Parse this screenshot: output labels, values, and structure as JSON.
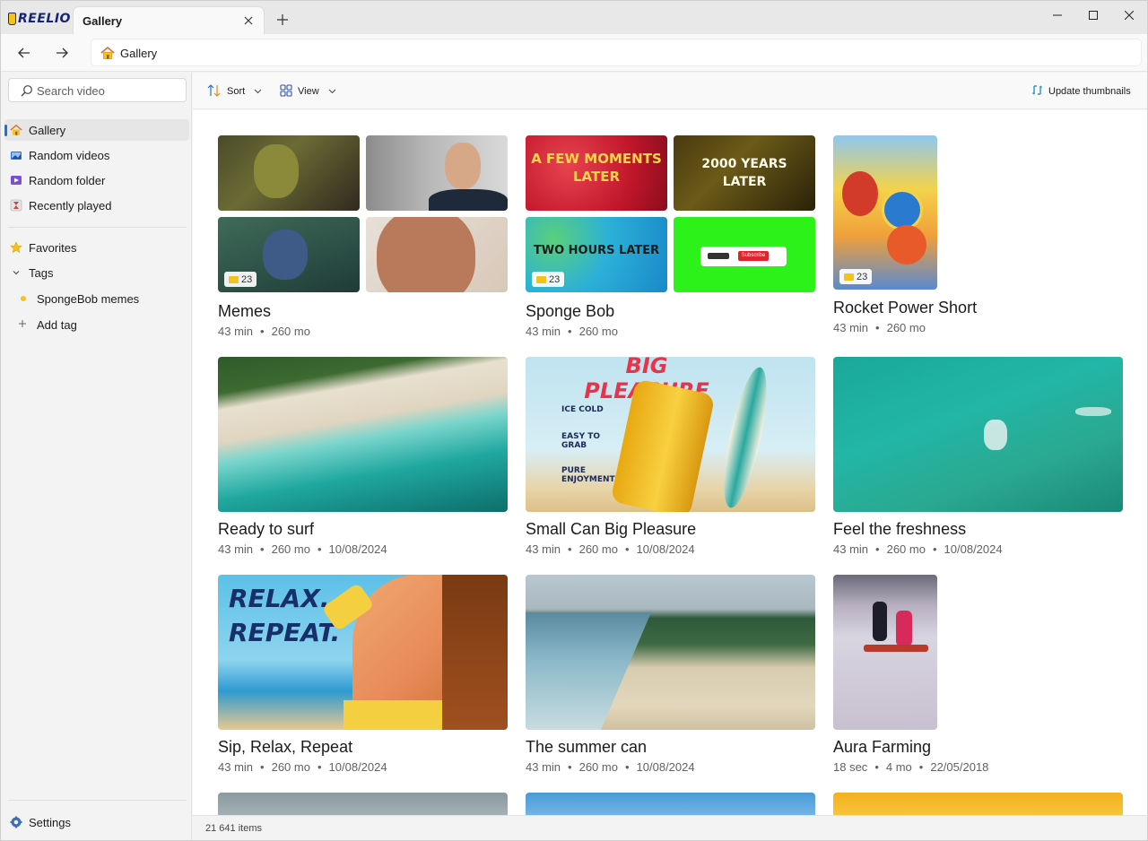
{
  "app": {
    "logo_text": "REELIO"
  },
  "tabs": [
    {
      "label": "Gallery"
    }
  ],
  "address": {
    "text": "Gallery"
  },
  "search": {
    "placeholder": "Search video"
  },
  "sidebar": {
    "items": [
      {
        "label": "Gallery",
        "active": true
      },
      {
        "label": "Random videos"
      },
      {
        "label": "Random folder"
      },
      {
        "label": "Recently played"
      }
    ],
    "favorites": "Favorites",
    "tags_label": "Tags",
    "tags": [
      {
        "label": "SpongeBob memes",
        "color": "#f4c21f"
      }
    ],
    "add_tag": "Add tag",
    "settings": "Settings"
  },
  "toolbar": {
    "sort": "Sort",
    "view": "View",
    "update": "Update thumbnails"
  },
  "status": {
    "items": "21 641 items"
  },
  "cards": [
    {
      "title": "Memes",
      "duration": "43 min",
      "age": "260 mo",
      "count": "23"
    },
    {
      "title": "Sponge Bob",
      "duration": "43 min",
      "age": "260 mo",
      "count": "23",
      "thumb_texts": [
        "A FEW MOMENTS LATER",
        "2000 YEARS LATER",
        "TWO HOURS LATER",
        "Subscribe"
      ]
    },
    {
      "title": "Rocket Power Short",
      "duration": "43 min",
      "age": "260 mo",
      "count": "23"
    },
    {
      "title": "Ready to surf",
      "duration": "43 min",
      "age": "260 mo",
      "date": "10/08/2024"
    },
    {
      "title": "Small Can Big Pleasure",
      "duration": "43 min",
      "age": "260 mo",
      "date": "10/08/2024",
      "thumb_texts": [
        "BIG PLEASURE",
        "ICE COLD",
        "EASY TO GRAB",
        "PURE ENJOYMENT"
      ]
    },
    {
      "title": "Feel the freshness",
      "duration": "43 min",
      "age": "260 mo",
      "date": "10/08/2024"
    },
    {
      "title": "Sip, Relax, Repeat",
      "duration": "43 min",
      "age": "260 mo",
      "date": "10/08/2024",
      "thumb_texts": [
        "RELAX.",
        "REPEAT."
      ]
    },
    {
      "title": "The summer can",
      "duration": "43 min",
      "age": "260 mo",
      "date": "10/08/2024"
    },
    {
      "title": "Aura Farming",
      "duration": "18 sec",
      "age": "4 mo",
      "date": "22/05/2018"
    }
  ],
  "colors": {
    "accent": "#1b6fe0",
    "brand": "#16237a",
    "tag": "#f4c21f"
  }
}
